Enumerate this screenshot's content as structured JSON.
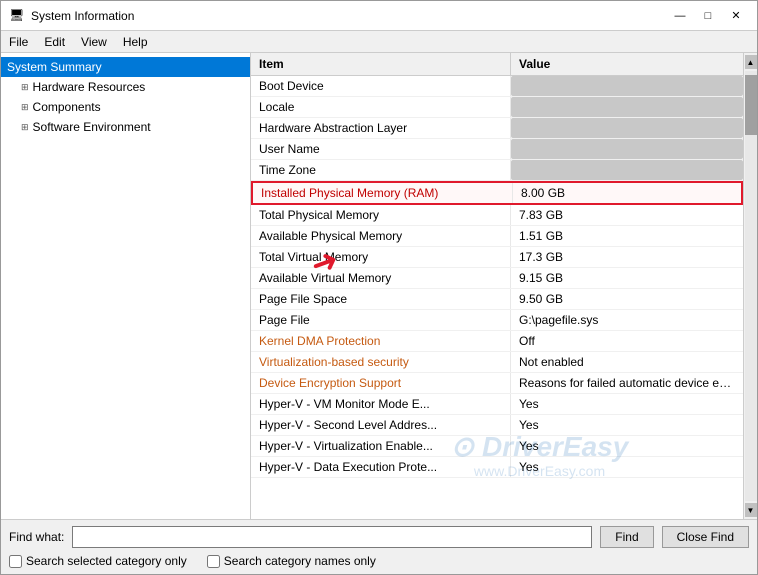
{
  "window": {
    "title": "System Information",
    "title_icon": "ℹ"
  },
  "title_buttons": {
    "minimize": "—",
    "maximize": "□",
    "close": "✕"
  },
  "menu": {
    "items": [
      "File",
      "Edit",
      "View",
      "Help"
    ]
  },
  "sidebar": {
    "items": [
      {
        "label": "System Summary",
        "active": true,
        "indent": 0
      },
      {
        "label": "Hardware Resources",
        "active": false,
        "indent": 1,
        "expand": "+"
      },
      {
        "label": "Components",
        "active": false,
        "indent": 1,
        "expand": "+"
      },
      {
        "label": "Software Environment",
        "active": false,
        "indent": 1,
        "expand": "+"
      }
    ]
  },
  "table": {
    "header": {
      "item": "Item",
      "value": "Value"
    },
    "rows": [
      {
        "item": "Boot Device",
        "value": "",
        "blurred": true
      },
      {
        "item": "Locale",
        "value": "",
        "blurred": true
      },
      {
        "item": "Hardware Abstraction Layer",
        "value": "",
        "blurred": true
      },
      {
        "item": "User Name",
        "value": "",
        "blurred": true
      },
      {
        "item": "Time Zone",
        "value": "",
        "blurred": true
      },
      {
        "item": "Installed Physical Memory (RAM)",
        "value": "8.00 GB",
        "highlighted": true,
        "item_color": "red"
      },
      {
        "item": "Total Physical Memory",
        "value": "7.83 GB",
        "item_color": "normal"
      },
      {
        "item": "Available Physical Memory",
        "value": "1.51 GB",
        "item_color": "normal"
      },
      {
        "item": "Total Virtual Memory",
        "value": "17.3 GB",
        "item_color": "normal"
      },
      {
        "item": "Available Virtual Memory",
        "value": "9.15 GB",
        "item_color": "normal"
      },
      {
        "item": "Page File Space",
        "value": "9.50 GB",
        "item_color": "normal"
      },
      {
        "item": "Page File",
        "value": "G:\\pagefile.sys",
        "item_color": "normal"
      },
      {
        "item": "Kernel DMA Protection",
        "value": "Off",
        "item_color": "orange"
      },
      {
        "item": "Virtualization-based security",
        "value": "Not enabled",
        "item_color": "orange"
      },
      {
        "item": "Device Encryption Support",
        "value": "Reasons for failed automatic device encryption",
        "item_color": "orange"
      },
      {
        "item": "Hyper-V - VM Monitor Mode E...",
        "value": "Yes",
        "item_color": "normal"
      },
      {
        "item": "Hyper-V - Second Level Addres...",
        "value": "Yes",
        "item_color": "normal"
      },
      {
        "item": "Hyper-V - Virtualization Enable...",
        "value": "Yes",
        "item_color": "normal"
      },
      {
        "item": "Hyper-V - Data Execution Prote...",
        "value": "Yes",
        "item_color": "normal"
      }
    ]
  },
  "bottom": {
    "find_label": "Find what:",
    "find_placeholder": "",
    "find_btn": "Find",
    "close_find_btn": "Close Find",
    "check1": "Search selected category only",
    "check2": "Search category names only"
  },
  "watermark": {
    "line1": "DriverEasy",
    "line2": "www.DriverEasy.com"
  }
}
